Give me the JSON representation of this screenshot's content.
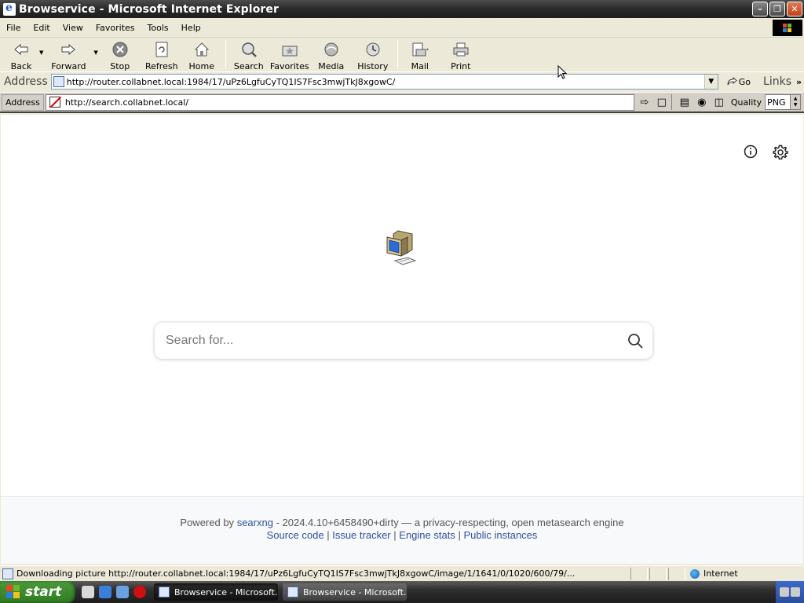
{
  "window": {
    "title": "Browservice - Microsoft Internet Explorer"
  },
  "menu": [
    "File",
    "Edit",
    "View",
    "Favorites",
    "Tools",
    "Help"
  ],
  "toolbar": {
    "back": "Back",
    "forward": "Forward",
    "stop": "Stop",
    "refresh": "Refresh",
    "home": "Home",
    "search": "Search",
    "favorites": "Favorites",
    "media": "Media",
    "history": "History",
    "mail": "Mail",
    "print": "Print"
  },
  "addressbar": {
    "label": "Address",
    "url": "http://router.collabnet.local:1984/17/uPz6LgfuCyTQ1IS7Fsc3mwjTkJ8xgowC/",
    "go": "Go",
    "links": "Links"
  },
  "browservice": {
    "address_label": "Address",
    "url": "http://search.collabnet.local/",
    "quality_label": "Quality",
    "quality_value": "PNG"
  },
  "page": {
    "search_placeholder": "Search for...",
    "footer": {
      "powered_by": "Powered by",
      "engine_name": "searxng",
      "version_text": "- 2024.4.10+6458490+dirty — a privacy-respecting, open metasearch engine",
      "links": [
        "Source code",
        "Issue tracker",
        "Engine stats",
        "Public instances"
      ],
      "separator": "|"
    }
  },
  "status": {
    "text": "Downloading picture http://router.collabnet.local:1984/17/uPz6LgfuCyTQ1IS7Fsc3mwjTkJ8xgowC/image/1/1641/0/1020/600/79/...",
    "zone": "Internet"
  },
  "taskbar": {
    "start": "start",
    "tasks": [
      "Browservice - Microsoft...",
      "Browservice - Microsoft..."
    ]
  },
  "colors": {
    "link": "#3050a0",
    "start_green": "#2f7a22",
    "titlebar": "#2a2a2a"
  }
}
